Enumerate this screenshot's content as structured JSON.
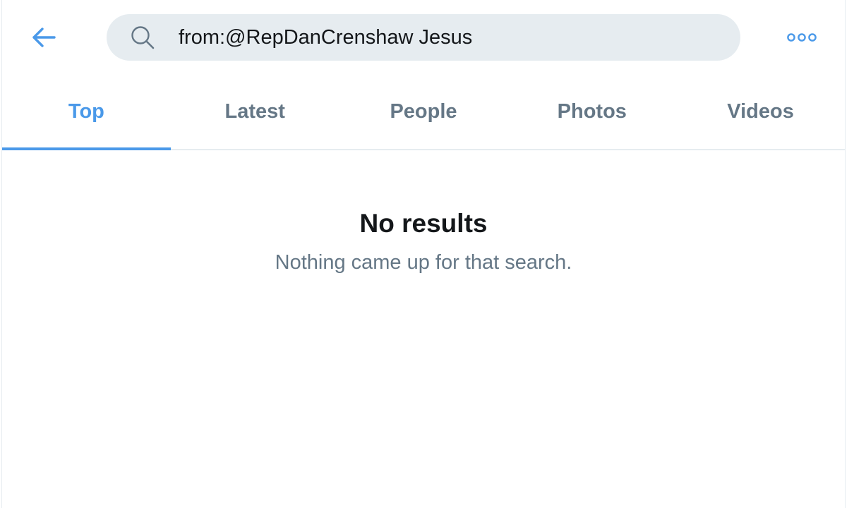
{
  "search": {
    "query": "from:@RepDanCrenshaw Jesus"
  },
  "header": {
    "back_icon": "arrow-left-icon",
    "more_icon": "more-options-icon",
    "accent_color": "#4a99e9"
  },
  "tabs": [
    {
      "label": "Top",
      "active": true
    },
    {
      "label": "Latest",
      "active": false
    },
    {
      "label": "People",
      "active": false
    },
    {
      "label": "Photos",
      "active": false
    },
    {
      "label": "Videos",
      "active": false
    }
  ],
  "empty_state": {
    "title": "No results",
    "message": "Nothing came up for that search."
  }
}
